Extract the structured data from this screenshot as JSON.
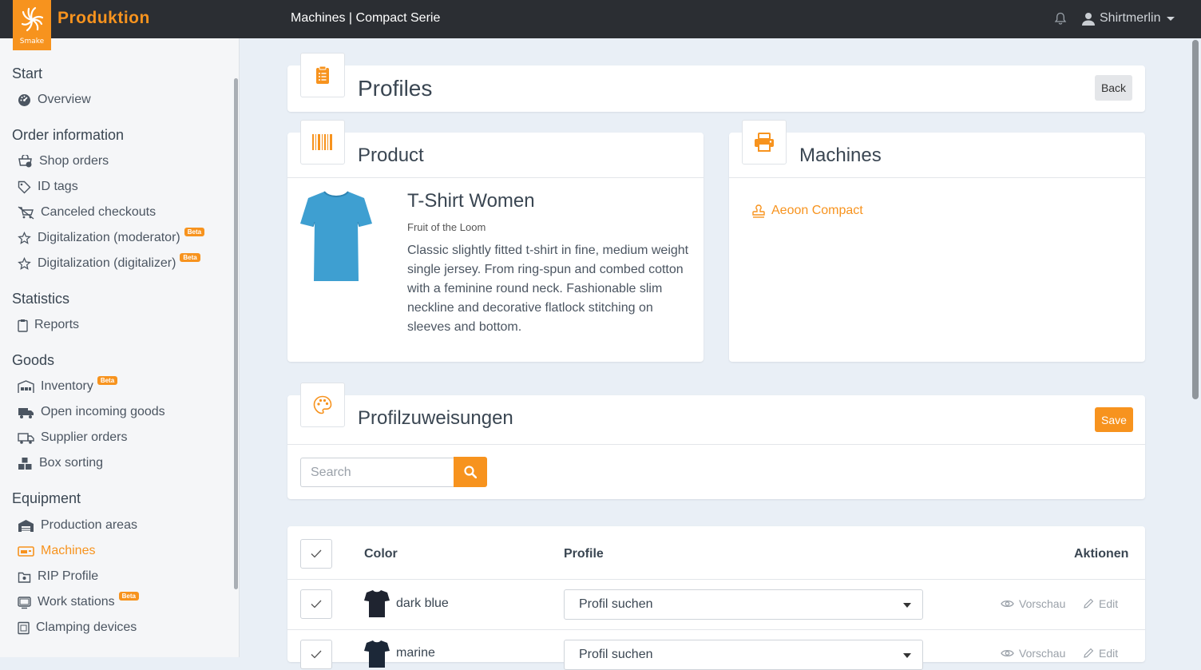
{
  "header": {
    "logo_text": "Smake",
    "app_title": "Produktion",
    "breadcrumb": "Machines | Compact Serie",
    "user_name": "Shirtmerlin"
  },
  "sidebar": {
    "sections": [
      {
        "title": "Start",
        "items": [
          {
            "label": "Overview",
            "icon": "dashboard-icon"
          }
        ]
      },
      {
        "title": "Order information",
        "items": [
          {
            "label": "Shop orders",
            "icon": "shop-cart-icon"
          },
          {
            "label": "ID tags",
            "icon": "tag-icon"
          },
          {
            "label": "Canceled checkouts",
            "icon": "canceled-cart-icon"
          },
          {
            "label": "Digitalization (moderator)",
            "icon": "magic-icon",
            "badge": "Beta"
          },
          {
            "label": "Digitalization (digitalizer)",
            "icon": "magic-icon",
            "badge": "Beta"
          }
        ]
      },
      {
        "title": "Statistics",
        "items": [
          {
            "label": "Reports",
            "icon": "clipboard-icon"
          }
        ]
      },
      {
        "title": "Goods",
        "items": [
          {
            "label": "Inventory",
            "icon": "warehouse-icon",
            "badge": "Beta"
          },
          {
            "label": "Open incoming goods",
            "icon": "truck-icon"
          },
          {
            "label": "Supplier orders",
            "icon": "shipping-icon"
          },
          {
            "label": "Box sorting",
            "icon": "boxes-icon"
          }
        ]
      },
      {
        "title": "Equipment",
        "items": [
          {
            "label": "Production areas",
            "icon": "factory-icon"
          },
          {
            "label": "Machines",
            "icon": "machine-icon",
            "active": true
          },
          {
            "label": "RIP Profile",
            "icon": "rip-profile-icon"
          },
          {
            "label": "Work stations",
            "icon": "workstation-icon",
            "badge": "Beta"
          },
          {
            "label": "Clamping devices",
            "icon": "clamp-icon"
          }
        ]
      }
    ]
  },
  "profiles_card": {
    "title": "Profiles",
    "back_label": "Back"
  },
  "product_card": {
    "title": "Product",
    "name": "T-Shirt Women",
    "brand": "Fruit of the Loom",
    "description": "Classic slightly fitted t-shirt in fine, medium weight single jersey. From ring-spun and combed cotton with a feminine round neck. Fashionable slim neckline and decorative flatlock stitching on sleeves and bottom.",
    "image_color": "#3e9fd1"
  },
  "machines_card": {
    "title": "Machines",
    "machine_name": "Aeoon Compact"
  },
  "assign_card": {
    "title": "Profilzuweisungen",
    "save_label": "Save",
    "search_placeholder": "Search"
  },
  "table": {
    "headers": {
      "color": "Color",
      "profile": "Profile",
      "actions": "Aktionen"
    },
    "rows": [
      {
        "color": "dark blue",
        "profile": "Profil suchen",
        "preview": "Vorschau",
        "edit": "Edit"
      },
      {
        "color": "marine",
        "profile": "Profil suchen",
        "preview": "Vorschau",
        "edit": "Edit"
      }
    ]
  },
  "colors": {
    "accent": "#f7931e",
    "topbar": "#2b2e33",
    "background": "#e9eff6"
  }
}
